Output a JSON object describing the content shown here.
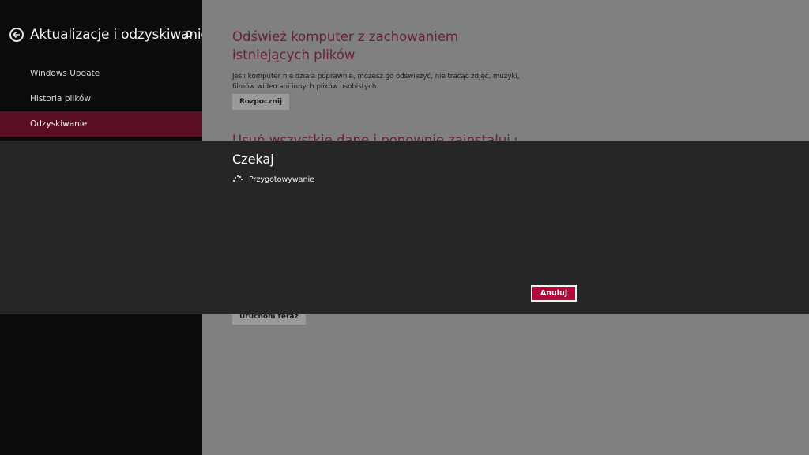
{
  "sidebar": {
    "title": "Aktualizacje i odzyskiwanie",
    "items": [
      {
        "label": "Windows Update"
      },
      {
        "label": "Historia plików"
      },
      {
        "label": "Odzyskiwanie",
        "selected": true
      }
    ]
  },
  "main": {
    "refresh": {
      "title": "Odśwież komputer z zachowaniem istniejących plików",
      "description": "Jeśli komputer nie działa poprawnie, możesz go odświeżyć, nie tracąc zdjęć, muzyki, filmów wideo ani innych plików osobistych.",
      "button": "Rozpocznij"
    },
    "reset": {
      "title_partial": "Usuń wszystkie dane i ponownie zainstaluj system"
    },
    "advanced": {
      "button": "Uruchom teraz"
    }
  },
  "dialog": {
    "title": "Czekaj",
    "status": "Przygotowywanie",
    "cancel": "Anuluj"
  },
  "colors": {
    "accent": "#b1083a",
    "selected_nav": "#5a0e24",
    "heading": "#6a1f38",
    "overlay": "#262626"
  },
  "icons": {
    "back": "back-arrow-circle-icon",
    "search": "search-icon",
    "spinner": "loading-spinner-icon"
  }
}
